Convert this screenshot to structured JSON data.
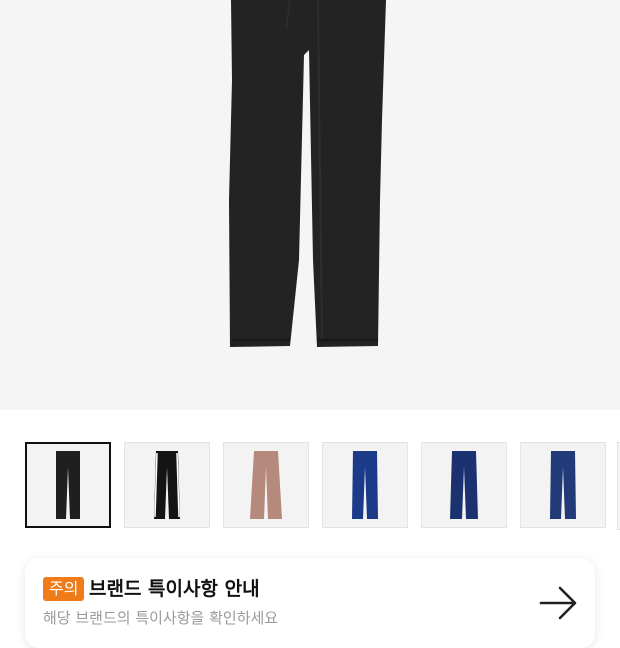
{
  "product": {
    "image_name": "track-pants-black",
    "selected_index": 0
  },
  "thumbnails": [
    {
      "color": "#1f1f1f",
      "stripe": "none"
    },
    {
      "color": "#141414",
      "stripe": "#ffffff"
    },
    {
      "color": "#b58a7c",
      "stripe": "none"
    },
    {
      "color": "#1c3a8a",
      "stripe": "none"
    },
    {
      "color": "#1c3270",
      "stripe": "none"
    },
    {
      "color": "#233a78",
      "stripe": "none"
    }
  ],
  "notice": {
    "badge": "주의",
    "title": "브랜드 특이사항 안내",
    "subtitle": "해당 브랜드의 특이사항을 확인하세요",
    "arrow_icon": "arrow-right-icon"
  },
  "colors": {
    "badge": "#ef7c19",
    "hero_bg": "#f5f5f5",
    "selected_border": "#111111"
  }
}
